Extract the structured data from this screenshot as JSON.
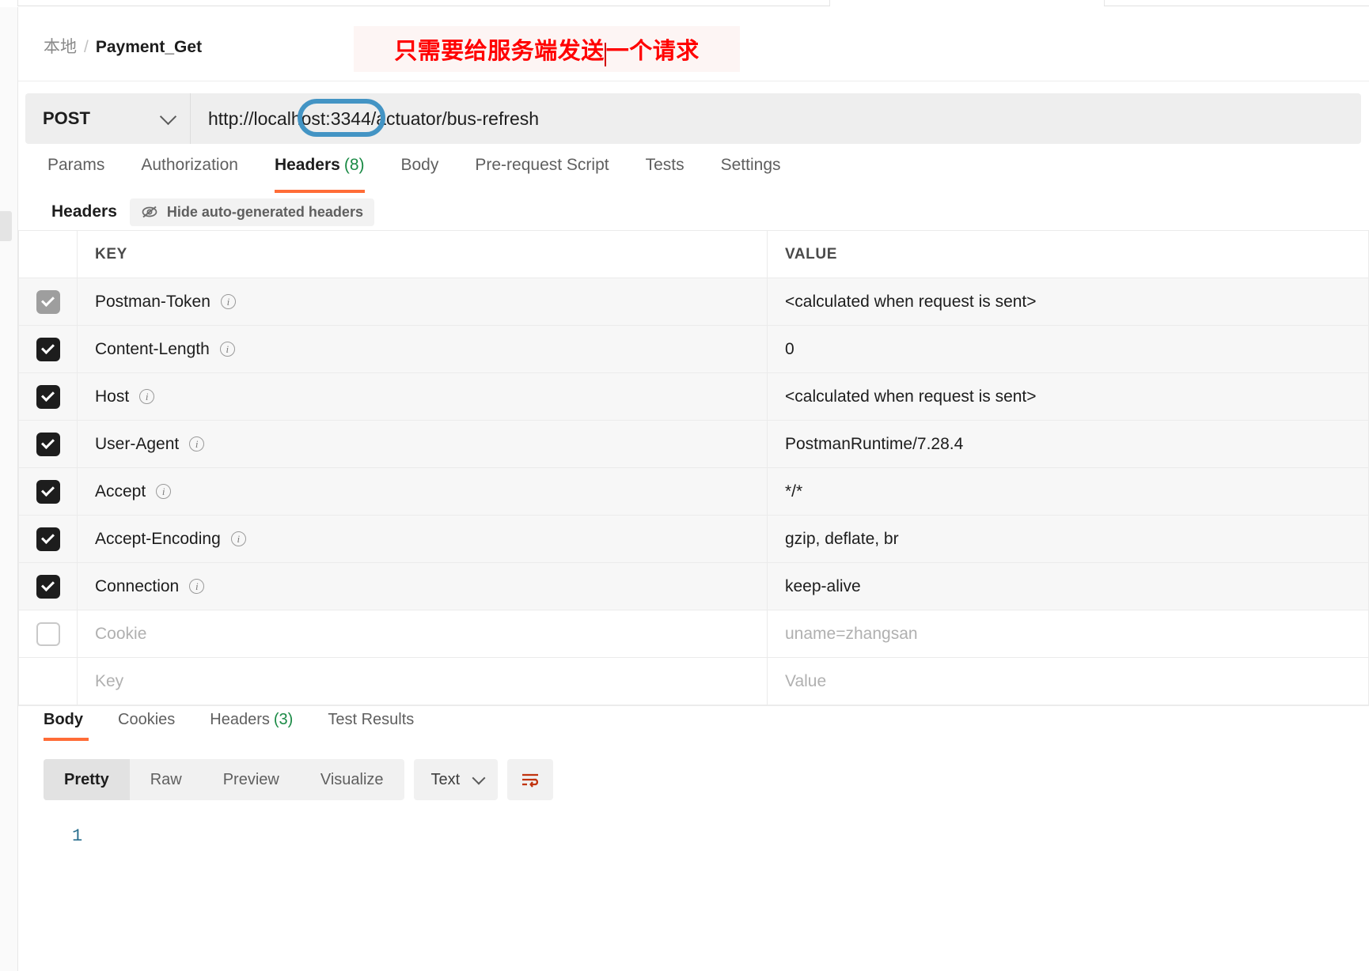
{
  "breadcrumb": {
    "root": "本地",
    "separator": "/",
    "leaf": "Payment_Get"
  },
  "annotation": {
    "text_before": "只需要给服务端发送",
    "text_after": "一个请求",
    "color": "#ff0000"
  },
  "request_bar": {
    "method": "POST",
    "method_icon": "chevron-down-icon",
    "url": "http://localhost:3344/actuator/bus-refresh",
    "highlight_color": "#4394c4"
  },
  "request_tabs": [
    {
      "label": "Params",
      "count": null,
      "active": false
    },
    {
      "label": "Authorization",
      "count": null,
      "active": false
    },
    {
      "label": "Headers",
      "count": "(8)",
      "active": true
    },
    {
      "label": "Body",
      "count": null,
      "active": false
    },
    {
      "label": "Pre-request Script",
      "count": null,
      "active": false
    },
    {
      "label": "Tests",
      "count": null,
      "active": false
    },
    {
      "label": "Settings",
      "count": null,
      "active": false
    }
  ],
  "headers_subbar": {
    "title": "Headers",
    "hide_auto_label": "Hide auto-generated headers",
    "hide_icon": "eye-slash-icon"
  },
  "headers_table": {
    "columns": {
      "key": "KEY",
      "value": "VALUE"
    },
    "rows": [
      {
        "checked": "dim",
        "key": "Postman-Token",
        "value": "<calculated when request is sent>",
        "auto": true,
        "placeholder": false
      },
      {
        "checked": "on",
        "key": "Content-Length",
        "value": "0",
        "auto": true,
        "placeholder": false
      },
      {
        "checked": "on",
        "key": "Host",
        "value": "<calculated when request is sent>",
        "auto": true,
        "placeholder": false
      },
      {
        "checked": "on",
        "key": "User-Agent",
        "value": "PostmanRuntime/7.28.4",
        "auto": true,
        "placeholder": false
      },
      {
        "checked": "on",
        "key": "Accept",
        "value": "*/*",
        "auto": true,
        "placeholder": false
      },
      {
        "checked": "on",
        "key": "Accept-Encoding",
        "value": "gzip, deflate, br",
        "auto": true,
        "placeholder": false
      },
      {
        "checked": "on",
        "key": "Connection",
        "value": "keep-alive",
        "auto": true,
        "placeholder": false
      },
      {
        "checked": "off",
        "key": "Cookie",
        "value": "uname=zhangsan",
        "auto": false,
        "placeholder": true
      },
      {
        "checked": "none",
        "key": "Key",
        "value": "Value",
        "auto": false,
        "placeholder": true
      }
    ]
  },
  "response_tabs": [
    {
      "label": "Body",
      "count": null,
      "active": true
    },
    {
      "label": "Cookies",
      "count": null,
      "active": false
    },
    {
      "label": "Headers",
      "count": "(3)",
      "active": false
    },
    {
      "label": "Test Results",
      "count": null,
      "active": false
    }
  ],
  "viewer_bar": {
    "segments": [
      {
        "label": "Pretty",
        "active": true
      },
      {
        "label": "Raw",
        "active": false
      },
      {
        "label": "Preview",
        "active": false
      },
      {
        "label": "Visualize",
        "active": false
      }
    ],
    "format": {
      "label": "Text",
      "icon": "chevron-down-icon"
    },
    "wrap_button_icon": "word-wrap-icon"
  },
  "code_viewer": {
    "line_numbers": [
      "1"
    ],
    "content": ""
  }
}
